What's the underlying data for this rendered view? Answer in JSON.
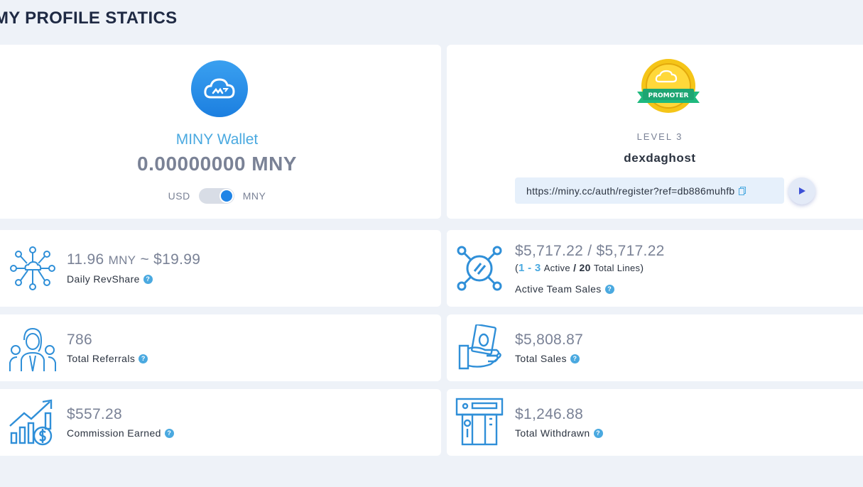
{
  "page": {
    "title": "MY PROFILE STATICS"
  },
  "wallet": {
    "name": "MINY Wallet",
    "balance": "0.00000000 MNY",
    "toggle_left": "USD",
    "toggle_right": "MNY",
    "toggle_on": true,
    "icon": "cloud-logo-icon"
  },
  "profile": {
    "badge_text": "PROMOTER",
    "level": "LEVEL 3",
    "username": "dexdaghost",
    "ref_link": "https://miny.cc/auth/register?ref=db886muhfb"
  },
  "stats": {
    "revshare": {
      "value_main": "11.96",
      "value_unit": "MNY",
      "value_rest": "~ $19.99",
      "label": "Daily RevShare",
      "icon": "network-nodes-icon"
    },
    "team_sales": {
      "value": "$5,717.22 / $5,717.22",
      "open": "(",
      "active_range": "1 - 3",
      "active_label": "Active",
      "sep": "/",
      "total_lines": "20",
      "total_lines_label": "Total Lines",
      "close": ")",
      "label": "Active Team Sales",
      "icon": "hub-icon"
    },
    "referrals": {
      "value": "786",
      "label": "Total Referrals",
      "icon": "team-icon"
    },
    "sales": {
      "value": "$5,808.87",
      "label": "Total Sales",
      "icon": "hand-money-icon"
    },
    "commission": {
      "value": "$557.28",
      "label": "Commission Earned",
      "icon": "growth-chart-icon"
    },
    "withdrawn": {
      "value": "$1,246.88",
      "label": "Total Withdrawn",
      "icon": "atm-icon"
    }
  },
  "colors": {
    "accent": "#4aa9e0",
    "primary": "#1f84e6",
    "title": "#1f2a44",
    "value": "#7a8296"
  }
}
